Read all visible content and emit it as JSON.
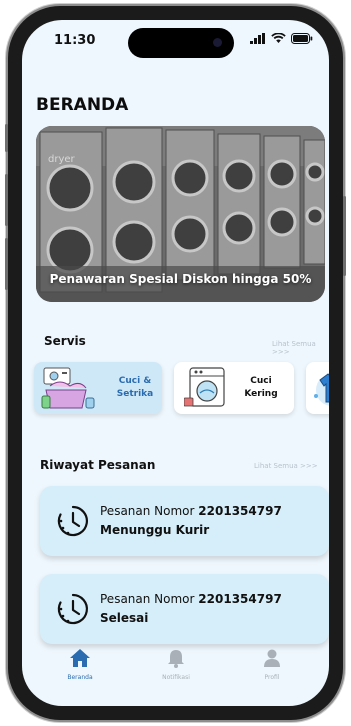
{
  "status_bar": {
    "time": "11:30"
  },
  "page": {
    "title": "BERANDA"
  },
  "banner": {
    "text": "Penawaran Spesial Diskon hingga 50%",
    "machine_label": "dryer"
  },
  "services": {
    "title": "Servis",
    "see_all": "Lihat Semua >>>",
    "items": [
      {
        "label_line1": "Cuci &",
        "label_line2": "Setrika",
        "icon": "laundry-basket-icon"
      },
      {
        "label_line1": "Cuci",
        "label_line2": "Kering",
        "icon": "washing-machine-icon"
      },
      {
        "label_line1": "",
        "label_line2": "",
        "icon": "tshirt-splash-icon"
      }
    ]
  },
  "orders": {
    "title": "Riwayat Pesanan",
    "see_all": "Lihat Semua >>>",
    "items": [
      {
        "prefix": "Pesanan Nomor",
        "number": "2201354797",
        "status": "Menunggu Kurir",
        "icon": "clock-icon"
      },
      {
        "prefix": "Pesanan Nomor",
        "number": "2201354797",
        "status": "Selesai",
        "icon": "clock-icon"
      }
    ]
  },
  "nav": {
    "items": [
      {
        "label": "Beranda",
        "icon": "home-icon"
      },
      {
        "label": "Notifikasi",
        "icon": "bell-icon"
      },
      {
        "label": "Profil",
        "icon": "user-icon"
      }
    ]
  },
  "colors": {
    "accent": "#2b6cb0",
    "screen_background": "#eef7fd",
    "card_active": "#cfe8f7",
    "order_card": "#d6eef9",
    "nav_inactive": "#a9b0b8"
  }
}
